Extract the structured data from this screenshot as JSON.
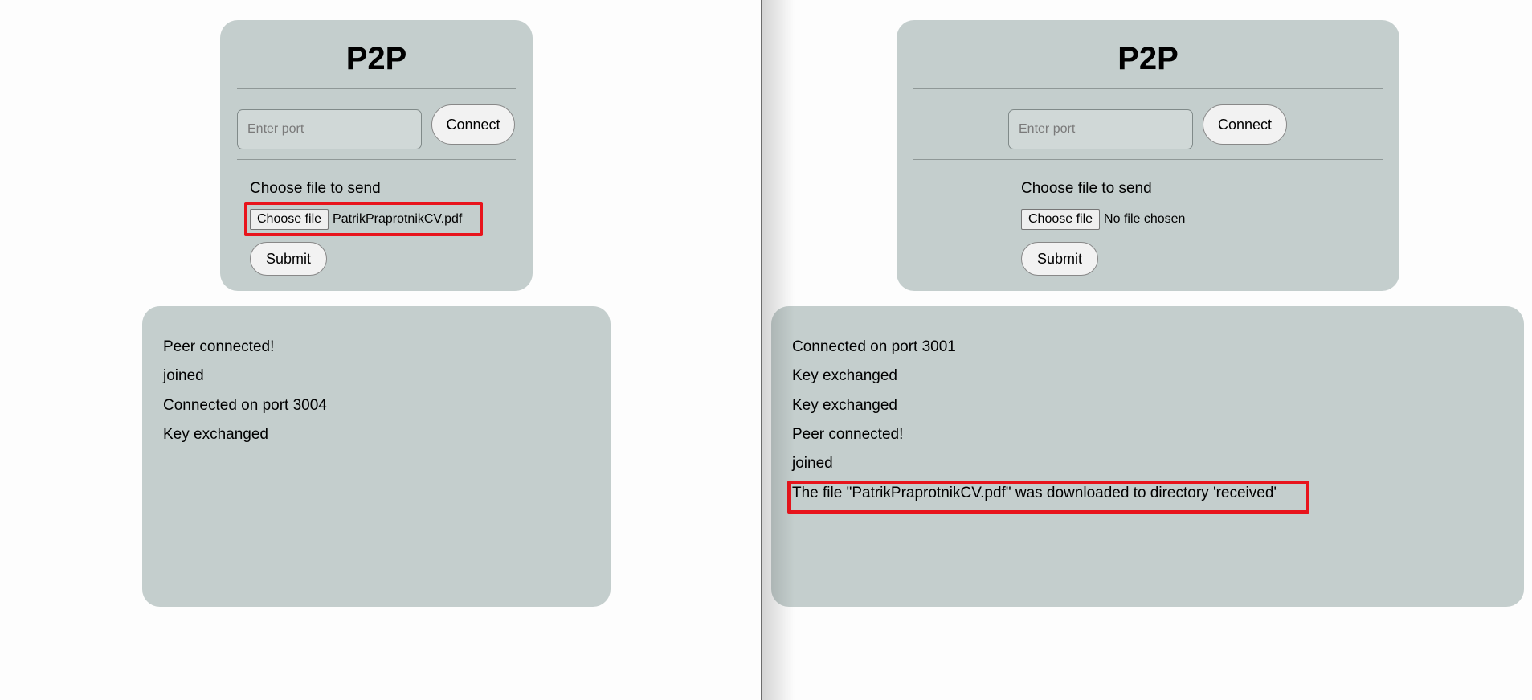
{
  "panes": [
    {
      "title": "P2P",
      "port_placeholder": "Enter port",
      "connect_label": "Connect",
      "file_label": "Choose file to send",
      "choose_file_label": "Choose file",
      "file_name": "PatrikPraprotnikCV.pdf",
      "submit_label": "Submit",
      "log": [
        "Peer connected!",
        "joined",
        "Connected on port 3004",
        "Key exchanged"
      ]
    },
    {
      "title": "P2P",
      "port_placeholder": "Enter port",
      "connect_label": "Connect",
      "file_label": "Choose file to send",
      "choose_file_label": "Choose file",
      "file_name": "No file chosen",
      "submit_label": "Submit",
      "log": [
        "Connected on port 3001",
        "Key exchanged",
        "Key exchanged",
        "Peer connected!",
        "joined",
        "The file \"PatrikPraprotnikCV.pdf\" was downloaded to directory 'received'"
      ]
    }
  ],
  "colors": {
    "card_background": "#c4cecd",
    "page_background": "#fdfdfd",
    "highlight": "#e8141c"
  }
}
